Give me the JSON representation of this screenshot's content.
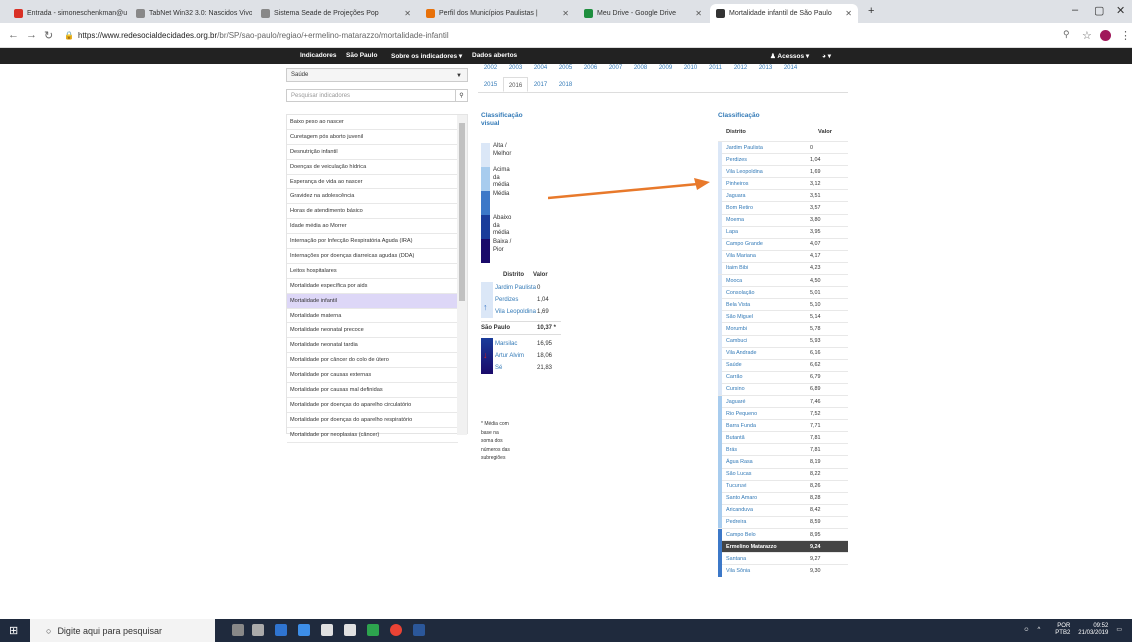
{
  "browser": {
    "tabs": [
      {
        "label": "Entrada - simoneschenkman@u",
        "color": "#d93025"
      },
      {
        "label": "TabNet Win32 3.0: Nascidos Vivo",
        "color": "#888888"
      },
      {
        "label": "Sistema Seade de Projeções Pop",
        "color": "#888888"
      },
      {
        "label": "Perfil dos Municípios Paulistas |",
        "color": "#e8710a"
      },
      {
        "label": "Meu Drive - Google Drive",
        "color": "#1e8e3e"
      },
      {
        "label": "Mortalidade infantil de São Paulo",
        "color": "#333333"
      }
    ],
    "url_host": "https://www.redesocialdecidades.org.br",
    "url_path": "/br/SP/sao-paulo/regiao/+ermelino-matarazzo/mortalidade-infantil"
  },
  "nav": {
    "indicadores": "Indicadores",
    "sao_paulo": "São Paulo",
    "sobre": "Sobre os indicadores ▾",
    "dados": "Dados abertos",
    "acessos": "♟ Acessos ▾",
    "globe": "◕ ▾"
  },
  "sidebar": {
    "category": "Saúde",
    "search_placeholder": "Pesquisar indicadores",
    "items": [
      "Baixo peso ao nascer",
      "Curetagem pós aborto juvenil",
      "Desnutrição infantil",
      "Doenças de veiculação hídrica",
      "Esperança de vida ao nascer",
      "Gravidez na adolescência",
      "Horas de atendimento básico",
      "Idade média ao Morrer",
      "Internação por Infecção Respiratória Aguda (IRA)",
      "Internações por doenças diarreicas agudas (DDA)",
      "Leitos hospitalares",
      "Mortalidade específica por aids",
      "Mortalidade infantil",
      "Mortalidade materna",
      "Mortalidade neonatal precoce",
      "Mortalidade neonatal tardia",
      "Mortalidade por câncer do colo de útero",
      "Mortalidade por causas externas",
      "Mortalidade por causas mal definidas",
      "Mortalidade por doenças do aparelho circulatório",
      "Mortalidade por doenças do aparelho respiratório",
      "Mortalidade por neoplasias (câncer)"
    ]
  },
  "years_row1": [
    "2002",
    "2003",
    "2004",
    "2005",
    "2006",
    "2007",
    "2008",
    "2009",
    "2010",
    "2011",
    "2012",
    "2013",
    "2014"
  ],
  "years_row2": [
    "2015",
    "2016",
    "2017",
    "2018"
  ],
  "visual": {
    "title": "Classificação visual",
    "legend": [
      {
        "text": "Alta / Melhor",
        "color": "#dbe7f7"
      },
      {
        "text": "Acima da média",
        "color": "#a8ccee"
      },
      {
        "text": "Média",
        "color": "#3c78c8"
      },
      {
        "text": "Abaixo da média",
        "color": "#1a3c9a"
      },
      {
        "text": "Baixa / Pior",
        "color": "#1a0a6a"
      }
    ],
    "col_distrito": "Distrito",
    "col_valor": "Valor",
    "best": [
      {
        "d": "Jardim Paulista",
        "v": "0"
      },
      {
        "d": "Perdizes",
        "v": "1,04"
      },
      {
        "d": "Vila Leopoldina",
        "v": "1,69"
      }
    ],
    "city": {
      "d": "São Paulo",
      "v": "10,37 *"
    },
    "worst": [
      {
        "d": "Marsilac",
        "v": "16,95"
      },
      {
        "d": "Artur Alvim",
        "v": "18,06"
      },
      {
        "d": "Sé",
        "v": "21,83"
      }
    ],
    "note": "* Média com base na soma dos números das subregiões"
  },
  "ranking": {
    "title": "Classificação",
    "col_distrito": "Distrito",
    "col_valor": "Valor",
    "rows": [
      {
        "d": "Jardim Paulista",
        "v": "0",
        "c": "#dbe7f7"
      },
      {
        "d": "Perdizes",
        "v": "1,04",
        "c": "#dbe7f7"
      },
      {
        "d": "Vila Leopoldina",
        "v": "1,69",
        "c": "#dbe7f7"
      },
      {
        "d": "Pinheiros",
        "v": "3,12",
        "c": "#dbe7f7"
      },
      {
        "d": "Jaguara",
        "v": "3,51",
        "c": "#dbe7f7"
      },
      {
        "d": "Bom Retiro",
        "v": "3,57",
        "c": "#dbe7f7"
      },
      {
        "d": "Moema",
        "v": "3,80",
        "c": "#dbe7f7"
      },
      {
        "d": "Lapa",
        "v": "3,95",
        "c": "#dbe7f7"
      },
      {
        "d": "Campo Grande",
        "v": "4,07",
        "c": "#dbe7f7"
      },
      {
        "d": "Vila Mariana",
        "v": "4,17",
        "c": "#dbe7f7"
      },
      {
        "d": "Itaim Bibi",
        "v": "4,23",
        "c": "#dbe7f7"
      },
      {
        "d": "Mooca",
        "v": "4,50",
        "c": "#dbe7f7"
      },
      {
        "d": "Consolação",
        "v": "5,01",
        "c": "#dbe7f7"
      },
      {
        "d": "Bela Vista",
        "v": "5,10",
        "c": "#dbe7f7"
      },
      {
        "d": "São Miguel",
        "v": "5,14",
        "c": "#dbe7f7"
      },
      {
        "d": "Morumbi",
        "v": "5,78",
        "c": "#dbe7f7"
      },
      {
        "d": "Cambuci",
        "v": "5,93",
        "c": "#dbe7f7"
      },
      {
        "d": "Vila Andrade",
        "v": "6,16",
        "c": "#dbe7f7"
      },
      {
        "d": "Saúde",
        "v": "6,62",
        "c": "#dbe7f7"
      },
      {
        "d": "Carrão",
        "v": "6,79",
        "c": "#dbe7f7"
      },
      {
        "d": "Cursino",
        "v": "6,89",
        "c": "#dbe7f7"
      },
      {
        "d": "Jaguaré",
        "v": "7,46",
        "c": "#a8ccee"
      },
      {
        "d": "Rio Pequeno",
        "v": "7,52",
        "c": "#a8ccee"
      },
      {
        "d": "Barra Funda",
        "v": "7,71",
        "c": "#a8ccee"
      },
      {
        "d": "Butantã",
        "v": "7,81",
        "c": "#a8ccee"
      },
      {
        "d": "Brás",
        "v": "7,81",
        "c": "#a8ccee"
      },
      {
        "d": "Água Rasa",
        "v": "8,19",
        "c": "#a8ccee"
      },
      {
        "d": "São Lucas",
        "v": "8,22",
        "c": "#a8ccee"
      },
      {
        "d": "Tucuruvi",
        "v": "8,26",
        "c": "#a8ccee"
      },
      {
        "d": "Santo Amaro",
        "v": "8,28",
        "c": "#a8ccee"
      },
      {
        "d": "Aricanduva",
        "v": "8,42",
        "c": "#a8ccee"
      },
      {
        "d": "Pedreira",
        "v": "8,59",
        "c": "#a8ccee"
      },
      {
        "d": "Campo Belo",
        "v": "8,95",
        "c": "#3c78c8"
      },
      {
        "d": "Ermelino Matarazzo",
        "v": "9,24",
        "c": "#3c78c8",
        "hl": true
      },
      {
        "d": "Santana",
        "v": "9,27",
        "c": "#3c78c8"
      },
      {
        "d": "Vila Sônia",
        "v": "9,30",
        "c": "#3c78c8"
      }
    ]
  },
  "taskbar": {
    "search": "Digite aqui para pesquisar",
    "lang": "POR PTB2",
    "time": "09:52",
    "date": "21/03/2019"
  }
}
